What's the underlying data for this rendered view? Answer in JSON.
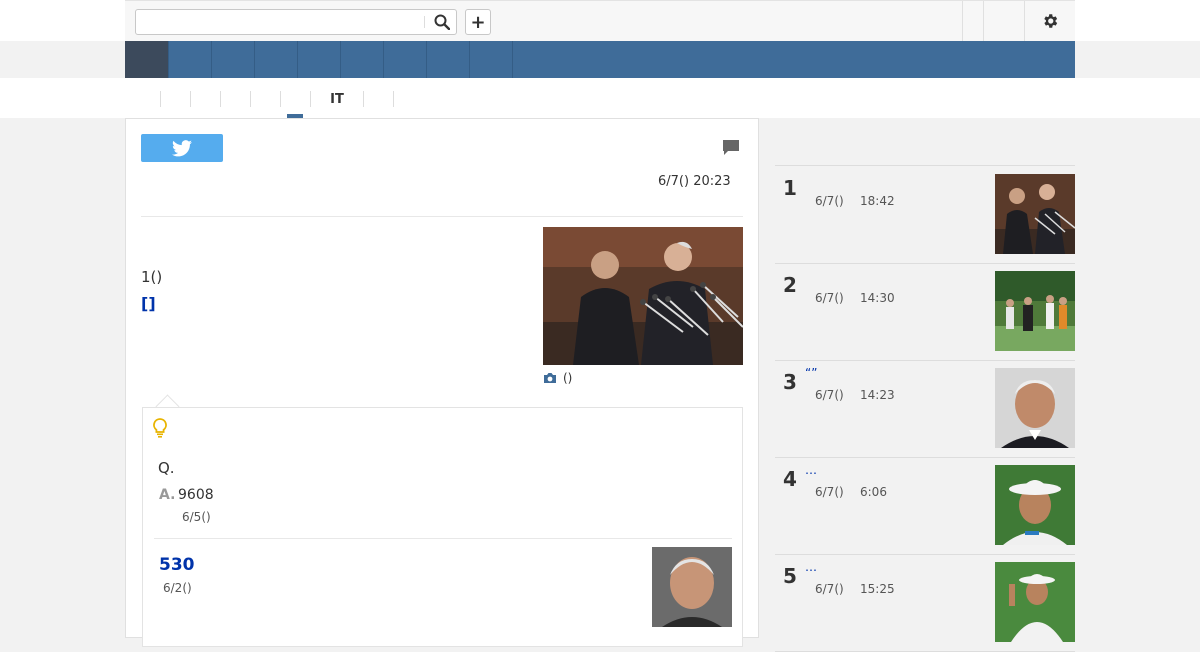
{
  "header": {
    "search": {
      "value": "",
      "placeholder": ""
    },
    "icons": {
      "search": "search-icon",
      "plus": "plus-icon",
      "settings": "gear-icon"
    },
    "plus_label": "+"
  },
  "navbar": {
    "accent": "#3f6c99",
    "home_color": "#3c4a5c",
    "items": [
      "",
      "",
      "",
      "",
      "",
      "",
      "",
      "",
      ""
    ]
  },
  "subnav": {
    "it_label": "IT"
  },
  "article": {
    "date": "6/7() 20:23",
    "lead_number": "1()",
    "lead_link": "[]",
    "photo_caption": "()",
    "icons": {
      "tweet": "twitter-icon",
      "comment": "comment-icon",
      "caption": "camera-icon",
      "qa": "lightbulb-icon"
    }
  },
  "qa": {
    "question": "Q.",
    "answer_label": "A.",
    "answer": "9608",
    "answer_date": "6/5()",
    "related_title": "530",
    "related_date": "6/2()"
  },
  "ranking": [
    {
      "rank": "1",
      "title": "",
      "date": "6/7()",
      "time": "18:42"
    },
    {
      "rank": "2",
      "title": "",
      "date": "6/7()",
      "time": "14:30"
    },
    {
      "rank": "3",
      "title": "“”",
      "date": "6/7()",
      "time": "14:23"
    },
    {
      "rank": "4",
      "title": "…",
      "date": "6/7()",
      "time": "6:06"
    },
    {
      "rank": "5",
      "title": "…",
      "date": "6/7()",
      "time": "15:25"
    }
  ]
}
